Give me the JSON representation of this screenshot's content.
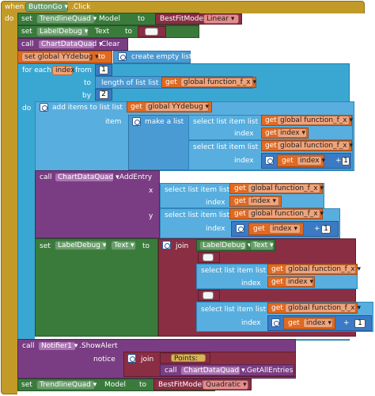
{
  "event": {
    "when": "when",
    "component": "ButtonGo",
    "event_name": ".Click",
    "do": "do"
  },
  "set_trendline_model": {
    "set": "set",
    "component": "TrendlineQuad",
    "prop": "Model",
    "to": "to",
    "value_call": "BestFitModel",
    "value_opt": "Linear"
  },
  "set_labeldebug_text": {
    "set": "set",
    "component": "LabelDebug",
    "prop": "Text",
    "to": "to",
    "value": " "
  },
  "call_chartclear": {
    "call": "call",
    "component": "ChartDataQuad",
    "method": ".Clear"
  },
  "set_yydebug": {
    "set": "set global YYdebug",
    "to": "to",
    "value": "create empty list"
  },
  "for_each": {
    "label": "for each",
    "var": "index",
    "from": "from",
    "from_val": "1",
    "to": "to",
    "to_expr": "length of list  list",
    "get_label": "get",
    "get_var": "global function_f_x",
    "by": "by",
    "by_val": "2",
    "do": "do"
  },
  "add_items": {
    "label": "add items to list  list",
    "get": "get",
    "var": "global YYdebug",
    "item": "item",
    "make_list": "make a list"
  },
  "select_list_item": "select list item  list",
  "get": "get",
  "global_fx": "global function_f_x",
  "index_label": "index",
  "var_index": "index",
  "plus": "+",
  "one": "1",
  "add_entry": {
    "call": "call",
    "component": "ChartDataQuad",
    "method": ".AddEntry",
    "x": "x",
    "y": "y"
  },
  "set_label_join": {
    "set": "set",
    "component": "LabelDebug",
    "prop": "Text",
    "to": "to",
    "join": "join",
    "join_comp": "LabelDebug",
    "join_prop": "Text",
    "str": " "
  },
  "show_alert": {
    "call": "call",
    "component": "Notifier1",
    "method": ".ShowAlert",
    "notice": "notice",
    "join": "join",
    "points": "Points:",
    "call2": "call",
    "comp2": "ChartDataQuad",
    "method2": ".GetAllEntries"
  },
  "set_trendline_quad": {
    "set": "set",
    "component": "TrendlineQuad",
    "prop": "Model",
    "to": "to",
    "value_call": "BestFitModel",
    "value_opt": "Quadratic"
  },
  "colors": {
    "event": "#c29a27",
    "set": "#3a7b3c",
    "call": "#7a3d83",
    "variable": "#e06a22",
    "list": "#4a9ad3",
    "math": "#3b7ac4",
    "text": "#8a2e44"
  }
}
